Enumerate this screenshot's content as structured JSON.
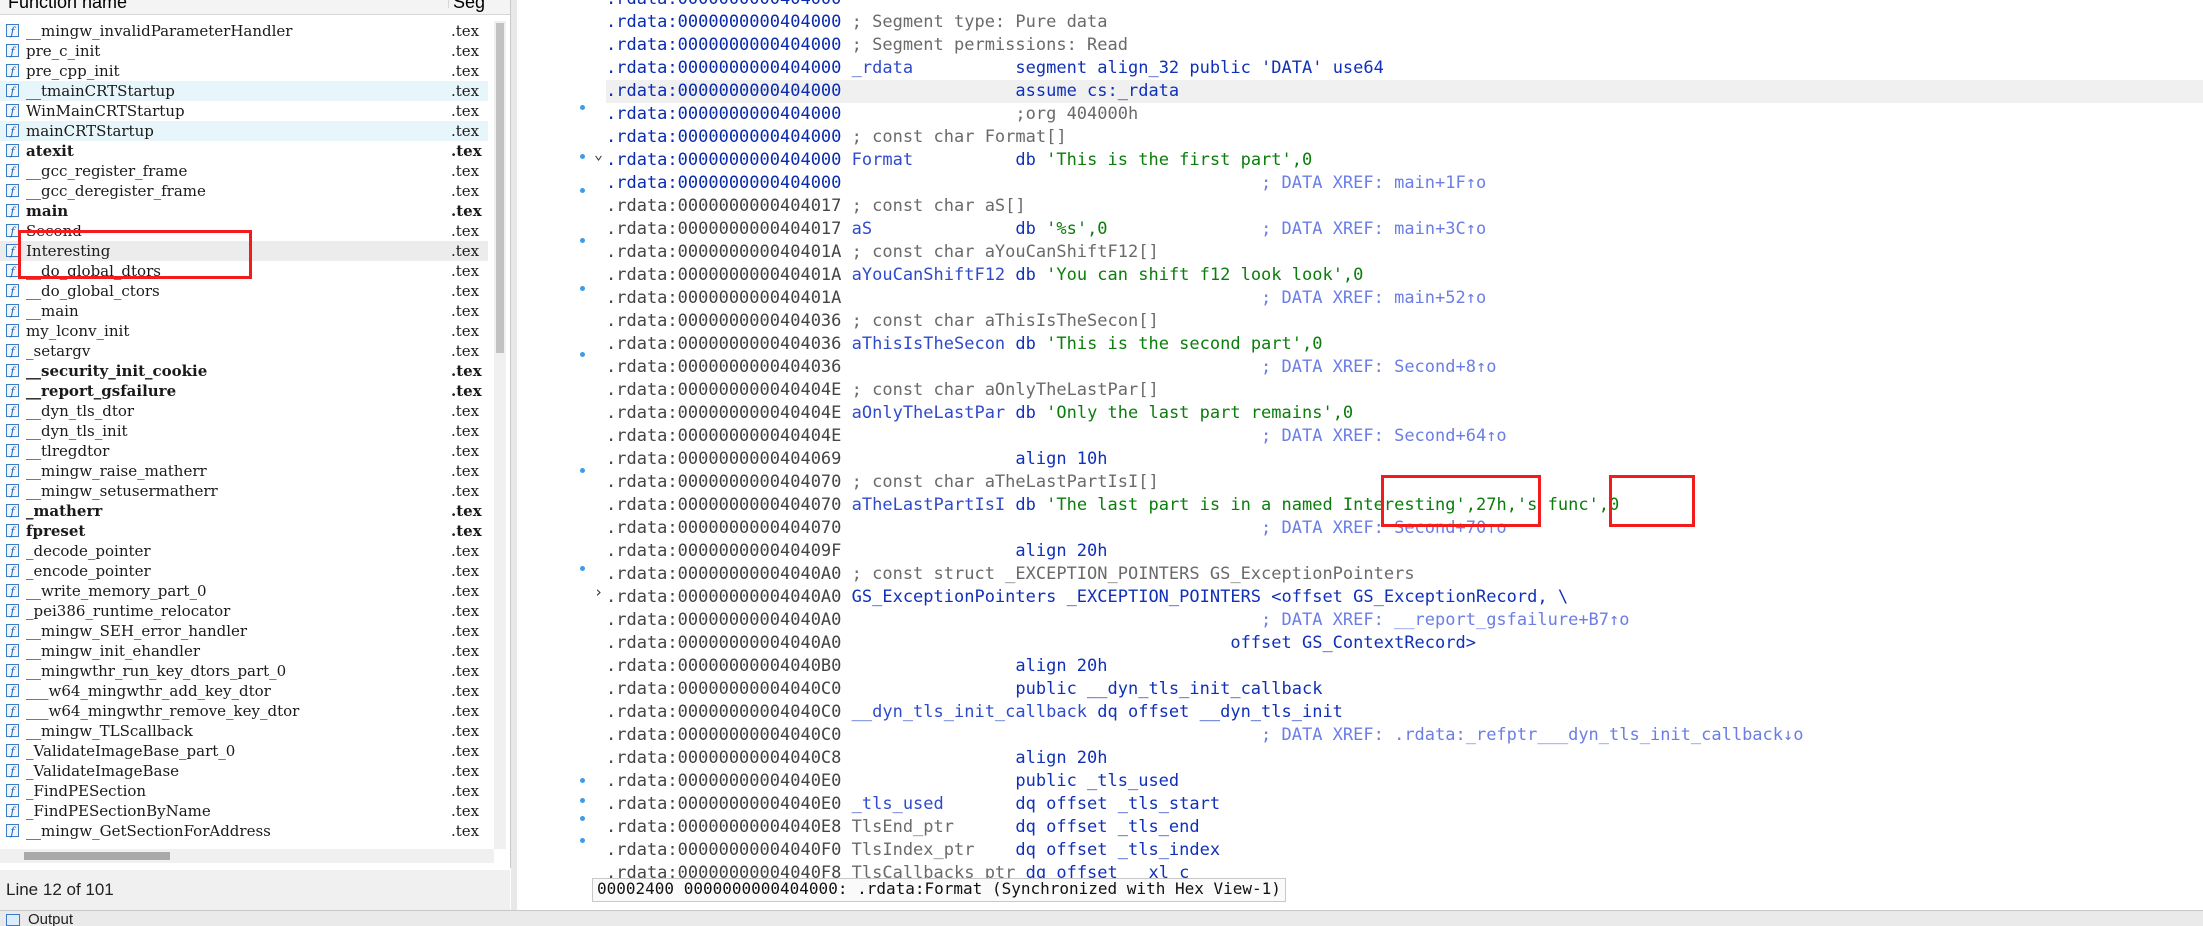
{
  "functions_panel": {
    "header_name": "Function name",
    "header_segment": "Seg",
    "status": "Line 12 of 101",
    "rows": [
      {
        "name": "__mingw_invalidParameterHandler",
        "seg": ".tex",
        "bold": false,
        "hl": false
      },
      {
        "name": "pre_c_init",
        "seg": ".tex",
        "bold": false,
        "hl": false
      },
      {
        "name": "pre_cpp_init",
        "seg": ".tex",
        "bold": false,
        "hl": false
      },
      {
        "name": "__tmainCRTStartup",
        "seg": ".tex",
        "bold": false,
        "hl": true
      },
      {
        "name": "WinMainCRTStartup",
        "seg": ".tex",
        "bold": false,
        "hl": false
      },
      {
        "name": "mainCRTStartup",
        "seg": ".tex",
        "bold": false,
        "hl": true
      },
      {
        "name": "atexit",
        "seg": ".tex",
        "bold": true,
        "hl": false
      },
      {
        "name": "__gcc_register_frame",
        "seg": ".tex",
        "bold": false,
        "hl": false
      },
      {
        "name": "__gcc_deregister_frame",
        "seg": ".tex",
        "bold": false,
        "hl": false
      },
      {
        "name": "main",
        "seg": ".tex",
        "bold": true,
        "hl": false
      },
      {
        "name": "Second",
        "seg": ".tex",
        "bold": false,
        "hl": false
      },
      {
        "name": "Interesting",
        "seg": ".tex",
        "bold": false,
        "hl": false,
        "sel": true
      },
      {
        "name": "__do_global_dtors",
        "seg": ".tex",
        "bold": false,
        "hl": false
      },
      {
        "name": "__do_global_ctors",
        "seg": ".tex",
        "bold": false,
        "hl": false
      },
      {
        "name": "__main",
        "seg": ".tex",
        "bold": false,
        "hl": false
      },
      {
        "name": "my_lconv_init",
        "seg": ".tex",
        "bold": false,
        "hl": false
      },
      {
        "name": "_setargv",
        "seg": ".tex",
        "bold": false,
        "hl": false
      },
      {
        "name": "__security_init_cookie",
        "seg": ".tex",
        "bold": true,
        "hl": false
      },
      {
        "name": "__report_gsfailure",
        "seg": ".tex",
        "bold": true,
        "hl": false
      },
      {
        "name": "__dyn_tls_dtor",
        "seg": ".tex",
        "bold": false,
        "hl": false
      },
      {
        "name": "__dyn_tls_init",
        "seg": ".tex",
        "bold": false,
        "hl": false
      },
      {
        "name": "__tlregdtor",
        "seg": ".tex",
        "bold": false,
        "hl": false
      },
      {
        "name": "__mingw_raise_matherr",
        "seg": ".tex",
        "bold": false,
        "hl": false
      },
      {
        "name": "__mingw_setusermatherr",
        "seg": ".tex",
        "bold": false,
        "hl": false
      },
      {
        "name": "_matherr",
        "seg": ".tex",
        "bold": true,
        "hl": false
      },
      {
        "name": "fpreset",
        "seg": ".tex",
        "bold": true,
        "hl": false
      },
      {
        "name": "_decode_pointer",
        "seg": ".tex",
        "bold": false,
        "hl": false
      },
      {
        "name": "_encode_pointer",
        "seg": ".tex",
        "bold": false,
        "hl": false
      },
      {
        "name": "__write_memory_part_0",
        "seg": ".tex",
        "bold": false,
        "hl": false
      },
      {
        "name": "_pei386_runtime_relocator",
        "seg": ".tex",
        "bold": false,
        "hl": false
      },
      {
        "name": "__mingw_SEH_error_handler",
        "seg": ".tex",
        "bold": false,
        "hl": false
      },
      {
        "name": "__mingw_init_ehandler",
        "seg": ".tex",
        "bold": false,
        "hl": false
      },
      {
        "name": "__mingwthr_run_key_dtors_part_0",
        "seg": ".tex",
        "bold": false,
        "hl": false
      },
      {
        "name": "___w64_mingwthr_add_key_dtor",
        "seg": ".tex",
        "bold": false,
        "hl": false
      },
      {
        "name": "___w64_mingwthr_remove_key_dtor",
        "seg": ".tex",
        "bold": false,
        "hl": false
      },
      {
        "name": "__mingw_TLScallback",
        "seg": ".tex",
        "bold": false,
        "hl": false
      },
      {
        "name": "_ValidateImageBase_part_0",
        "seg": ".tex",
        "bold": false,
        "hl": false
      },
      {
        "name": "_ValidateImageBase",
        "seg": ".tex",
        "bold": false,
        "hl": false
      },
      {
        "name": "_FindPESection",
        "seg": ".tex",
        "bold": false,
        "hl": false
      },
      {
        "name": "_FindPESectionByName",
        "seg": ".tex",
        "bold": false,
        "hl": false
      },
      {
        "name": "__mingw_GetSectionForAddress",
        "seg": ".tex",
        "bold": false,
        "hl": false
      }
    ]
  },
  "disasm": {
    "status": "00002400 0000000000404000: .rdata:Format (Synchronized with Hex View-1)",
    "lines": [
      [
        {
          "t": ".rdata:0000000000404000",
          "c": "addr-blue"
        }
      ],
      [
        {
          "t": ".rdata:0000000000404000 ",
          "c": "addr-blue"
        },
        {
          "t": "; Segment type: Pure data",
          "c": "c-gray"
        }
      ],
      [
        {
          "t": ".rdata:0000000000404000 ",
          "c": "addr-blue"
        },
        {
          "t": "; Segment permissions: Read",
          "c": "c-gray"
        }
      ],
      [
        {
          "t": ".rdata:0000000000404000 ",
          "c": "addr-blue"
        },
        {
          "t": "_rdata",
          "c": "c-blue"
        },
        {
          "t": "          segment align_32 public 'DATA' use64",
          "c": "c-kw"
        }
      ],
      [
        {
          "t": ".rdata:0000000000404000 ",
          "c": "addr-blue"
        },
        {
          "t": "                assume cs:_rdata",
          "c": "c-kw"
        }
      ],
      [
        {
          "t": ".rdata:0000000000404000 ",
          "c": "addr-blue"
        },
        {
          "t": "                ;org 404000h",
          "c": "c-gray"
        }
      ],
      [
        {
          "t": ".rdata:0000000000404000 ",
          "c": "addr-blue"
        },
        {
          "t": "; const char Format[]",
          "c": "c-gray"
        }
      ],
      [
        {
          "t": ".rdata:0000000000404000 ",
          "c": "addr-blue"
        },
        {
          "t": "Format",
          "c": "c-blue"
        },
        {
          "t": "          db ",
          "c": "c-kw"
        },
        {
          "t": "'This is the first part'",
          "c": "c-green"
        },
        {
          "t": ",0",
          "c": "c-green"
        }
      ],
      [
        {
          "t": ".rdata:0000000000404000 ",
          "c": "addr-blue"
        },
        {
          "t": "                                        ; DATA XREF: main+1F↑o",
          "c": "c-xref"
        }
      ],
      [
        {
          "t": ".rdata:0000000000404017 ",
          "c": "addr-gray"
        },
        {
          "t": "; const char aS[]",
          "c": "c-gray"
        }
      ],
      [
        {
          "t": ".rdata:0000000000404017 ",
          "c": "addr-gray"
        },
        {
          "t": "aS",
          "c": "c-blue"
        },
        {
          "t": "              db ",
          "c": "c-kw"
        },
        {
          "t": "'%s',0",
          "c": "c-green"
        },
        {
          "t": "               ; DATA XREF: main+3C↑o",
          "c": "c-xref"
        }
      ],
      [
        {
          "t": ".rdata:000000000040401A ",
          "c": "addr-gray"
        },
        {
          "t": "; const char aYouCanShiftF12[]",
          "c": "c-gray"
        }
      ],
      [
        {
          "t": ".rdata:000000000040401A ",
          "c": "addr-gray"
        },
        {
          "t": "aYouCanShiftF12",
          "c": "c-blue"
        },
        {
          "t": " db ",
          "c": "c-kw"
        },
        {
          "t": "'You can shift f12 look look',0",
          "c": "c-green"
        }
      ],
      [
        {
          "t": ".rdata:000000000040401A ",
          "c": "addr-gray"
        },
        {
          "t": "                                        ; DATA XREF: main+52↑o",
          "c": "c-xref"
        }
      ],
      [
        {
          "t": ".rdata:0000000000404036 ",
          "c": "addr-gray"
        },
        {
          "t": "; const char aThisIsTheSecon[]",
          "c": "c-gray"
        }
      ],
      [
        {
          "t": ".rdata:0000000000404036 ",
          "c": "addr-gray"
        },
        {
          "t": "aThisIsTheSecon",
          "c": "c-blue"
        },
        {
          "t": " db ",
          "c": "c-kw"
        },
        {
          "t": "'This is the second part',0",
          "c": "c-green"
        }
      ],
      [
        {
          "t": ".rdata:0000000000404036 ",
          "c": "addr-gray"
        },
        {
          "t": "                                        ; DATA XREF: Second+8↑o",
          "c": "c-xref"
        }
      ],
      [
        {
          "t": ".rdata:000000000040404E ",
          "c": "addr-gray"
        },
        {
          "t": "; const char aOnlyTheLastPar[]",
          "c": "c-gray"
        }
      ],
      [
        {
          "t": ".rdata:000000000040404E ",
          "c": "addr-gray"
        },
        {
          "t": "aOnlyTheLastPar",
          "c": "c-blue"
        },
        {
          "t": " db ",
          "c": "c-kw"
        },
        {
          "t": "'Only the last part remains',0",
          "c": "c-green"
        }
      ],
      [
        {
          "t": ".rdata:000000000040404E ",
          "c": "addr-gray"
        },
        {
          "t": "                                        ; DATA XREF: Second+64↑o",
          "c": "c-xref"
        }
      ],
      [
        {
          "t": ".rdata:0000000000404069 ",
          "c": "addr-gray"
        },
        {
          "t": "                align 10h",
          "c": "c-kw"
        }
      ],
      [
        {
          "t": ".rdata:0000000000404070 ",
          "c": "addr-gray"
        },
        {
          "t": "; const char aTheLastPartIsI[]",
          "c": "c-gray"
        }
      ],
      [
        {
          "t": ".rdata:0000000000404070 ",
          "c": "addr-gray"
        },
        {
          "t": "aTheLastPartIsI",
          "c": "c-blue"
        },
        {
          "t": " db ",
          "c": "c-kw"
        },
        {
          "t": "'The last part is in a named Interesting',27h,'s func',0",
          "c": "c-green"
        }
      ],
      [
        {
          "t": ".rdata:0000000000404070 ",
          "c": "addr-gray"
        },
        {
          "t": "                                        ; DATA XREF: Second+70↑o",
          "c": "c-xref"
        }
      ],
      [
        {
          "t": ".rdata:000000000040409F ",
          "c": "addr-gray"
        },
        {
          "t": "                align 20h",
          "c": "c-kw"
        }
      ],
      [
        {
          "t": ".rdata:00000000004040A0 ",
          "c": "addr-gray"
        },
        {
          "t": "; const struct _EXCEPTION_POINTERS GS_ExceptionPointers",
          "c": "c-gray"
        }
      ],
      [
        {
          "t": ".rdata:00000000004040A0 ",
          "c": "addr-gray"
        },
        {
          "t": "GS_ExceptionPointers _EXCEPTION_POINTERS <offset GS_ExceptionRecord, \\",
          "c": "c-kw"
        }
      ],
      [
        {
          "t": ".rdata:00000000004040A0 ",
          "c": "addr-gray"
        },
        {
          "t": "                                        ; DATA XREF: __report_gsfailure+B7↑o",
          "c": "c-xref"
        }
      ],
      [
        {
          "t": ".rdata:00000000004040A0 ",
          "c": "addr-gray"
        },
        {
          "t": "                                     offset GS_ContextRecord>",
          "c": "c-kw"
        }
      ],
      [
        {
          "t": ".rdata:00000000004040B0 ",
          "c": "addr-gray"
        },
        {
          "t": "                align 20h",
          "c": "c-kw"
        }
      ],
      [
        {
          "t": ".rdata:00000000004040C0 ",
          "c": "addr-gray"
        },
        {
          "t": "                public __dyn_tls_init_callback",
          "c": "c-kw"
        }
      ],
      [
        {
          "t": ".rdata:00000000004040C0 ",
          "c": "addr-gray"
        },
        {
          "t": "__dyn_tls_init_callback",
          "c": "c-blue"
        },
        {
          "t": " dq offset __dyn_tls_init",
          "c": "c-kw"
        }
      ],
      [
        {
          "t": ".rdata:00000000004040C0 ",
          "c": "addr-gray"
        },
        {
          "t": "                                        ; DATA XREF: .rdata:_refptr___dyn_tls_init_callback↓o",
          "c": "c-xref"
        }
      ],
      [
        {
          "t": ".rdata:00000000004040C8 ",
          "c": "addr-gray"
        },
        {
          "t": "                align 20h",
          "c": "c-kw"
        }
      ],
      [
        {
          "t": ".rdata:00000000004040E0 ",
          "c": "addr-gray"
        },
        {
          "t": "                public _tls_used",
          "c": "c-kw"
        }
      ],
      [
        {
          "t": ".rdata:00000000004040E0 ",
          "c": "addr-gray"
        },
        {
          "t": "_tls_used",
          "c": "c-blue"
        },
        {
          "t": "       dq offset _tls_start",
          "c": "c-kw"
        }
      ],
      [
        {
          "t": ".rdata:00000000004040E8 ",
          "c": "addr-gray"
        },
        {
          "t": "TlsEnd_ptr",
          "c": "c-gray"
        },
        {
          "t": "      dq offset _tls_end",
          "c": "c-kw"
        }
      ],
      [
        {
          "t": ".rdata:00000000004040F0 ",
          "c": "addr-gray"
        },
        {
          "t": "TlsIndex_ptr",
          "c": "c-gray"
        },
        {
          "t": "    dq offset _tls_index",
          "c": "c-kw"
        }
      ],
      [
        {
          "t": ".rdata:00000000004040F8 ",
          "c": "addr-gray"
        },
        {
          "t": "TlsCallbacks_ptr",
          "c": "c-gray"
        },
        {
          "t": " dq offset __xl_c",
          "c": "c-kw"
        }
      ]
    ]
  },
  "output_tab": {
    "label": "Output"
  }
}
